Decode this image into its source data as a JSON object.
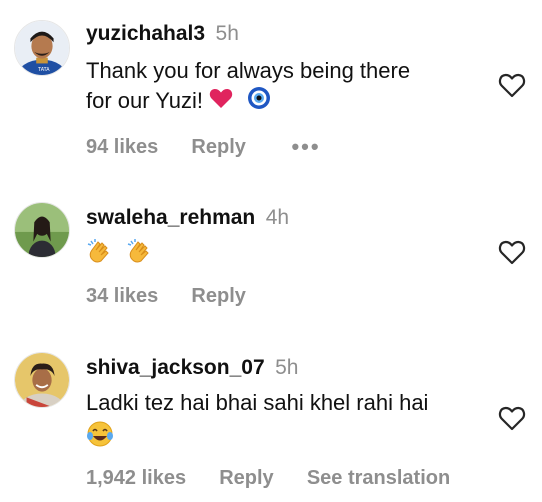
{
  "comments": [
    {
      "username": "yuzichahal3",
      "time": "5h",
      "text_line1": "Thank you for always being there",
      "text_line2": "for our Yuzi!",
      "emojis": [
        "red-heart",
        "nazar-amulet"
      ],
      "likes": "94 likes",
      "reply": "Reply",
      "more": "•••"
    },
    {
      "username": "swaleha_rehman",
      "time": "4h",
      "emojis": [
        "clapping-hands",
        "clapping-hands"
      ],
      "likes": "34 likes",
      "reply": "Reply"
    },
    {
      "username": "shiva_jackson_07",
      "time": "5h",
      "text_line1": "Ladki tez hai bhai sahi khel rahi hai",
      "emojis": [
        "tears-of-joy"
      ],
      "likes": "1,942 likes",
      "reply": "Reply",
      "translate": "See translation"
    }
  ],
  "colors": {
    "secondary_text": "#8e8e8e",
    "primary_text": "#111111",
    "heart_emoji": "#e0245e"
  }
}
